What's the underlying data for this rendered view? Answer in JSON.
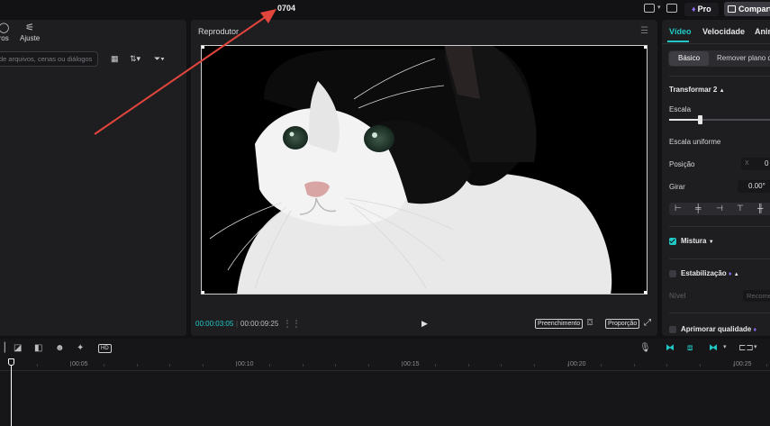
{
  "topbar": {
    "project_title": "0704",
    "pro_label": "Pro",
    "share_label": "Compartilhar"
  },
  "left_panel": {
    "tabs": [
      {
        "label": "ros",
        "icon": "filters-icon"
      },
      {
        "label": "Ajuste",
        "icon": "adjust-sliders-icon"
      }
    ],
    "search_placeholder": "de arquivos, cenas ou diálogos"
  },
  "player": {
    "title": "Reprodutor",
    "current_time": "00:00:03:05",
    "total_time": "00:00:09:25",
    "fill_label": "Preenchimento",
    "ratio_label": "Proporção"
  },
  "right_panel": {
    "tabs": [
      "Vídeo",
      "Velocidade",
      "Animação"
    ],
    "subtabs": [
      "Básico",
      "Remover plano de fundo"
    ],
    "transform_label": "Transformar 2",
    "scale_label": "Escala",
    "scale_value": 0.3,
    "uniform_scale_label": "Escala uniforme",
    "position_label": "Posição",
    "position_x_prefix": "X",
    "position_x_value": "0",
    "rotate_label": "Girar",
    "rotate_value": "0.00°",
    "blend_label": "Mistura",
    "stabilize_label": "Estabilização",
    "level_label": "Nível",
    "level_value": "Recomendado",
    "enhance_label": "Aprimorar qualidade"
  },
  "timeline": {
    "ticks": [
      "00:05",
      "00:10",
      "00:15",
      "00:20",
      "00:25"
    ]
  },
  "colors": {
    "accent": "#20c9c6",
    "pro_gem": "#8d6cf0",
    "annotation_arrow": "#e2453c"
  }
}
